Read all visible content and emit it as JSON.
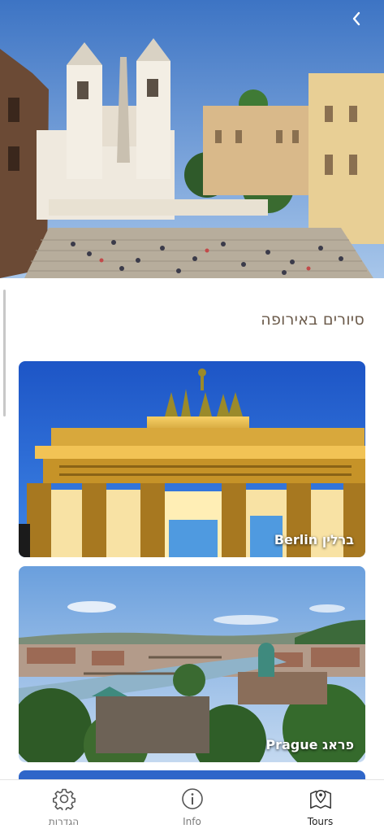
{
  "hero": {
    "image": "spanish-steps-rome-photo"
  },
  "icons": {
    "back": "chevron-left-icon",
    "settings": "gear-icon",
    "info": "info-icon",
    "tours": "map-pin-icon"
  },
  "section": {
    "title": "סיורים באירופה"
  },
  "cards": [
    {
      "label": "Berlin ברלין",
      "image": "brandenburg-gate-photo"
    },
    {
      "label": "Prague פראג",
      "image": "prague-skyline-photo"
    }
  ],
  "nav": {
    "items": [
      {
        "label": "הגדרות",
        "icon": "gear-icon",
        "active": false
      },
      {
        "label": "Info",
        "icon": "info-icon",
        "active": false
      },
      {
        "label": "Tours",
        "icon": "map-pin-icon",
        "active": true
      }
    ]
  }
}
